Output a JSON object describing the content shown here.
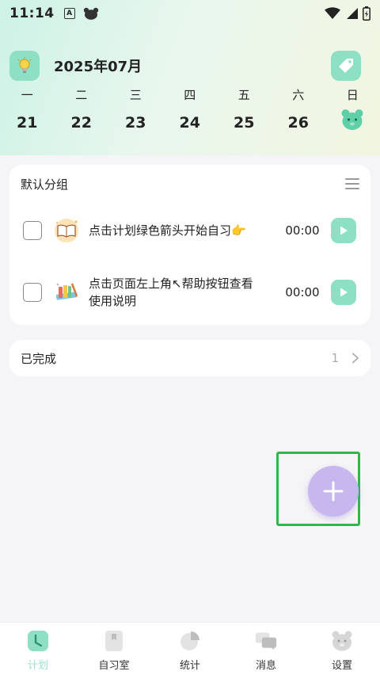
{
  "status_bar": {
    "time": "11:14",
    "a_icon_letter": "A"
  },
  "header": {
    "month": "2025年07月",
    "weekdays": [
      {
        "label": "一",
        "date": "21"
      },
      {
        "label": "二",
        "date": "22"
      },
      {
        "label": "三",
        "date": "23"
      },
      {
        "label": "四",
        "date": "24"
      },
      {
        "label": "五",
        "date": "25"
      },
      {
        "label": "六",
        "date": "26"
      },
      {
        "label": "日",
        "date": ""
      }
    ]
  },
  "group": {
    "title": "默认分组",
    "tasks": [
      {
        "text": "点击计划绿色箭头开始自习👉",
        "time": "00:00",
        "icon": "book-icon"
      },
      {
        "text": "点击页面左上角↖帮助按钮查看使用说明",
        "time": "00:00",
        "icon": "books-pencil-icon"
      }
    ]
  },
  "completed": {
    "title": "已完成",
    "count": "1"
  },
  "bottom_nav": [
    {
      "label": "计划",
      "icon": "clock-icon",
      "active": true
    },
    {
      "label": "自习室",
      "icon": "bookmark-icon",
      "active": false
    },
    {
      "label": "统计",
      "icon": "pie-chart-icon",
      "active": false
    },
    {
      "label": "消息",
      "icon": "chat-icon",
      "active": false
    },
    {
      "label": "设置",
      "icon": "bear-icon",
      "active": false
    }
  ],
  "colors": {
    "accent": "#8ee0c4",
    "fab": "#c8b6ee",
    "highlight": "#2fb84a"
  }
}
